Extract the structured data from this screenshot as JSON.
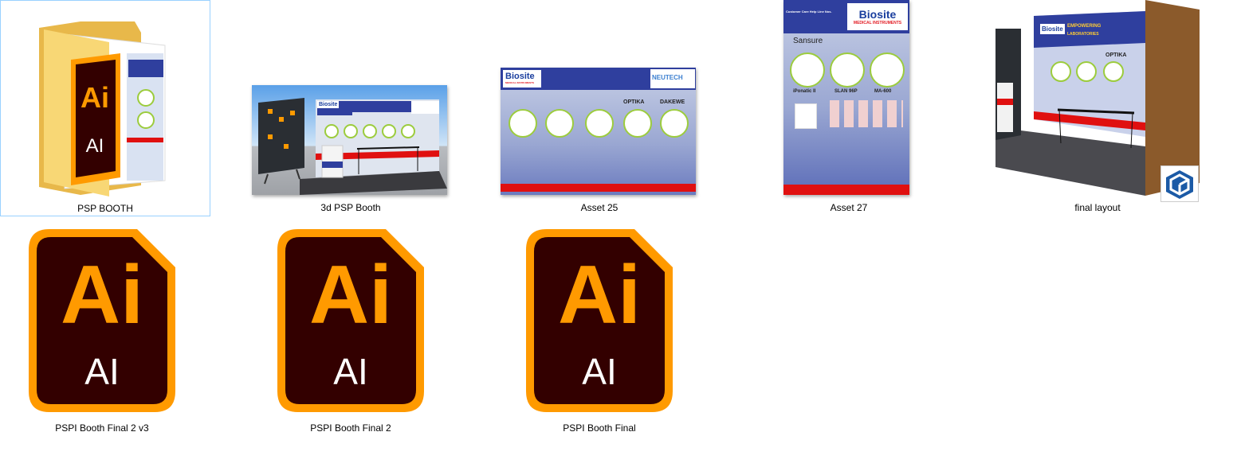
{
  "files": [
    {
      "label": "PSP BOOTH",
      "type": "folder",
      "icon": "folder-icon"
    },
    {
      "label": "3d PSP Booth",
      "type": "image"
    },
    {
      "label": "Asset 25",
      "type": "image"
    },
    {
      "label": "Asset 27",
      "type": "image"
    },
    {
      "label": "final layout",
      "type": "sketchup"
    },
    {
      "label": "PSPI Booth Final 2 v3",
      "type": "ai"
    },
    {
      "label": "PSPI Booth Final 2",
      "type": "ai"
    },
    {
      "label": "PSPI Booth Final",
      "type": "ai"
    }
  ],
  "ai_icon": {
    "big": "Ai",
    "small": "AI"
  },
  "thumbs": {
    "brand": "Biosite",
    "brand_sub": "MEDICAL INSTRUMENTS",
    "asset25": {
      "partner": "NEUTECH",
      "brands": [
        "OPTIKA",
        "DAKEWE"
      ]
    },
    "asset27": {
      "header": "Customer Care Help Line Nos.",
      "partner": "Sansure",
      "models": [
        "iPonatic II",
        "SLAN 96P",
        "MA-600"
      ]
    },
    "final": {
      "headline": "EMPOWERING",
      "headline2": "LABORATORIES",
      "brand2": "OPTIKA"
    }
  },
  "colors": {
    "ai_orange": "#FF9A00",
    "ai_bg": "#330000",
    "folder": "#F8D775",
    "selection": "#99d1ff",
    "banner_blue": "#2f3f9e",
    "banner_red": "#e01010",
    "sketchup": "#1b5aa6"
  }
}
